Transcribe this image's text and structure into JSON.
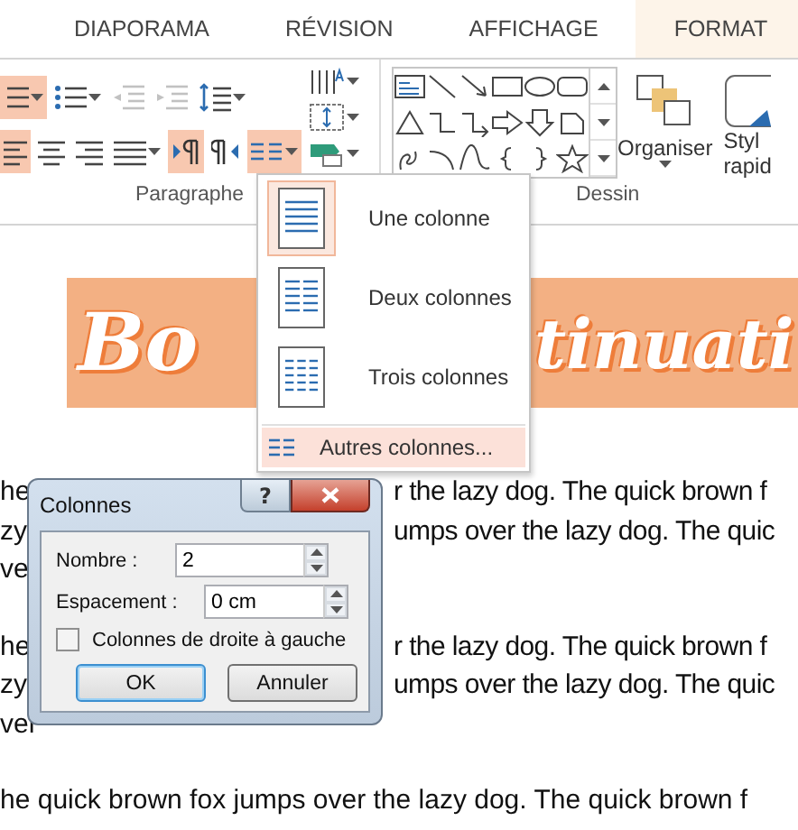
{
  "tabs": [
    {
      "label": "DIAPORAMA",
      "selected": false
    },
    {
      "label": "RÉVISION",
      "selected": false
    },
    {
      "label": "AFFICHAGE",
      "selected": false
    },
    {
      "label": "FORMAT",
      "selected": true
    }
  ],
  "paragraph_group": {
    "label": "Paragraphe",
    "row_1": [
      {
        "kind": "bullets",
        "selected": true,
        "dropdown": true,
        "disabled": false
      },
      {
        "kind": "numbering",
        "selected": false,
        "dropdown": true,
        "disabled": false
      },
      {
        "kind": "decrease_indent",
        "selected": false,
        "dropdown": false,
        "disabled": true
      },
      {
        "kind": "increase_indent",
        "selected": false,
        "dropdown": false,
        "disabled": true
      },
      {
        "kind": "line_spacing",
        "selected": false,
        "dropdown": true,
        "disabled": false
      }
    ],
    "row_2": [
      {
        "kind": "align_left",
        "selected": true,
        "dropdown": false,
        "disabled": false
      },
      {
        "kind": "align_center",
        "selected": false,
        "dropdown": false,
        "disabled": false
      },
      {
        "kind": "align_right",
        "selected": false,
        "dropdown": false,
        "disabled": false
      },
      {
        "kind": "justify",
        "selected": false,
        "dropdown": true,
        "disabled": false
      },
      {
        "kind": "ltr",
        "selected": true,
        "dropdown": false,
        "disabled": false
      },
      {
        "kind": "rtl",
        "selected": false,
        "dropdown": false,
        "disabled": false
      },
      {
        "kind": "columns",
        "selected": true,
        "dropdown": true,
        "disabled": false
      }
    ],
    "side": [
      {
        "kind": "text_direction",
        "selected": false,
        "dropdown": true,
        "disabled": false
      },
      {
        "kind": "align_text",
        "selected": false,
        "dropdown": true,
        "disabled": false
      },
      {
        "kind": "smartart",
        "selected": false,
        "dropdown": true,
        "disabled": false
      }
    ]
  },
  "drawing_group": {
    "label": "Dessin",
    "arrange_label": "Organiser",
    "styles_label_lines": [
      "Styl",
      "rapid"
    ]
  },
  "banner": {
    "left": "Bo",
    "right": "tinuati"
  },
  "document": [
    [
      {
        "left": "he",
        "right": "r the lazy dog. The quick brown f"
      },
      {
        "left": "zy",
        "right": "umps over the lazy dog. The quic"
      },
      {
        "left": "ve"
      }
    ],
    [
      {
        "left": "he",
        "right": "r the lazy dog. The quick brown f"
      },
      {
        "left": "zy",
        "right": "umps over the lazy dog. The quic"
      },
      {
        "left": "ver"
      }
    ],
    [
      {
        "left": "he quick brown fox jumps over the lazy dog. The quick brown f"
      }
    ]
  ],
  "columns_menu": {
    "items": [
      {
        "label": "Une colonne",
        "selected": true
      },
      {
        "label": "Deux colonnes",
        "selected": false
      },
      {
        "label": "Trois colonnes",
        "selected": false
      }
    ],
    "more": {
      "label": "Autres colonnes...",
      "hovered": true
    }
  },
  "dialog": {
    "title": "Colonnes",
    "help": "?",
    "fields": [
      {
        "label": "Nombre :",
        "value": "2"
      },
      {
        "label": "Espacement :",
        "value": "0 cm"
      }
    ],
    "checkbox": {
      "label": "Colonnes de droite à gauche",
      "checked": false
    },
    "buttons": [
      {
        "label": "OK",
        "default": true
      },
      {
        "label": "Annuler",
        "default": false
      }
    ]
  }
}
